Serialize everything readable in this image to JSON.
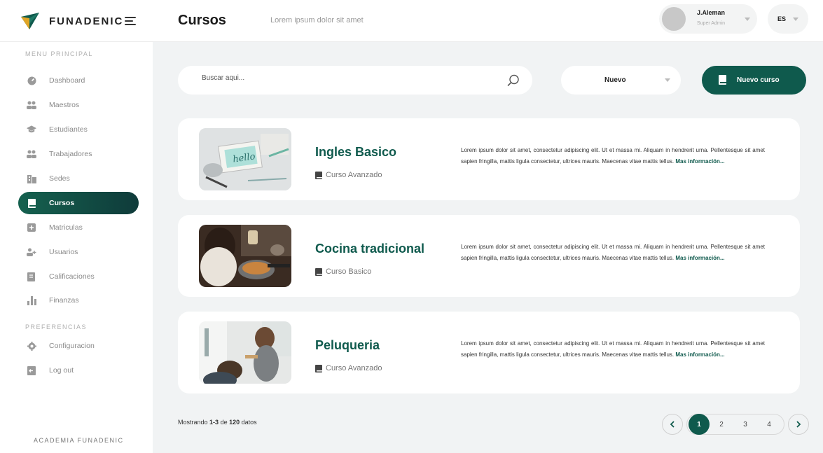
{
  "brand": {
    "name": "FUNADENIC",
    "footer": "ACADEMIA FUNADENIC"
  },
  "header": {
    "title": "Cursos",
    "subtitle": "Lorem ipsum  dolor sit amet"
  },
  "user": {
    "name": "J.Aleman",
    "role": "Super Admin"
  },
  "language": {
    "current": "ES"
  },
  "sidebar": {
    "main_label": "MENU PRINCIPAL",
    "prefs_label": "PREFERENCIAS",
    "items": [
      {
        "label": "Dashboard",
        "icon": "dashboard-icon"
      },
      {
        "label": "Maestros",
        "icon": "teachers-icon"
      },
      {
        "label": "Estudiantes",
        "icon": "graduation-cap-icon"
      },
      {
        "label": "Trabajadores",
        "icon": "workers-icon"
      },
      {
        "label": "Sedes",
        "icon": "building-icon"
      },
      {
        "label": "Cursos",
        "icon": "book-icon",
        "active": true
      },
      {
        "label": "Matriculas",
        "icon": "plus-square-icon"
      },
      {
        "label": "Usuarios",
        "icon": "add-user-icon"
      },
      {
        "label": "Calificaciones",
        "icon": "grades-icon"
      },
      {
        "label": "Finanzas",
        "icon": "bar-chart-icon"
      }
    ],
    "pref_items": [
      {
        "label": "Configuracion",
        "icon": "gear-icon"
      },
      {
        "label": "Log out",
        "icon": "logout-icon"
      }
    ]
  },
  "toolbar": {
    "search_placeholder": "Buscar aqui...",
    "filter_value": "Nuevo",
    "new_button": "Nuevo curso"
  },
  "courses": [
    {
      "title": "Ingles Basico",
      "level": "Curso Avanzado",
      "description": "Lorem ipsum dolor sit amet, consectetur adipiscing elit. Ut et massa mi. Aliquam in hendrerit urna. Pellentesque sit amet sapien fringilla, mattis ligula consectetur, ultrices mauris. Maecenas vitae mattis tellus.",
      "more": "Mas información..."
    },
    {
      "title": "Cocina tradicional",
      "level": "Curso Basico",
      "description": "Lorem ipsum dolor sit amet, consectetur adipiscing elit. Ut et massa mi. Aliquam in hendrerit urna. Pellentesque sit amet sapien fringilla, mattis ligula consectetur, ultrices mauris. Maecenas vitae mattis tellus.",
      "more": "Mas información..."
    },
    {
      "title": "Peluqueria",
      "level": "Curso Avanzado",
      "description": "Lorem ipsum dolor sit amet, consectetur adipiscing elit. Ut et massa mi. Aliquam in hendrerit urna. Pellentesque sit amet sapien fringilla, mattis ligula consectetur, ultrices mauris. Maecenas vitae mattis tellus.",
      "more": "Mas información..."
    }
  ],
  "pagination": {
    "prefix": "Mostrando",
    "range": "1-3",
    "of": "de",
    "total": "120",
    "suffix": "datos",
    "pages": [
      "1",
      "2",
      "3",
      "4"
    ],
    "current": "1"
  },
  "colors": {
    "primary": "#0f5a4d",
    "background": "#f1f3f4",
    "sidebar": "#ffffff"
  }
}
